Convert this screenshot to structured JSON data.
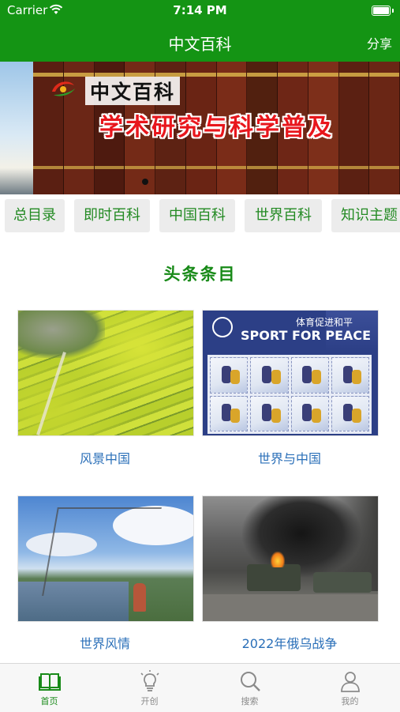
{
  "status_bar": {
    "carrier": "Carrier",
    "time": "7:14 PM"
  },
  "nav": {
    "title": "中文百科",
    "share_label": "分享"
  },
  "banner": {
    "logo_text": "中文百科",
    "slogan": "学术研究与科学普及",
    "page_indicator": {
      "current": 1,
      "total": 1
    }
  },
  "categories": [
    "总目录",
    "即时百科",
    "中国百科",
    "世界百科",
    "知识主题"
  ],
  "section_title": "头条条目",
  "articles": [
    {
      "label": "风景中国"
    },
    {
      "label": "世界与中国",
      "image_text_1": "体育促进和平",
      "image_text_2": "SPORT FOR PEACE"
    },
    {
      "label": "世界风情"
    },
    {
      "label": "2022年俄乌战争"
    }
  ],
  "tabs": [
    {
      "label": "首页",
      "icon": "book-icon",
      "active": true
    },
    {
      "label": "开创",
      "icon": "lightbulb-icon",
      "active": false
    },
    {
      "label": "搜索",
      "icon": "search-icon",
      "active": false
    },
    {
      "label": "我的",
      "icon": "person-icon",
      "active": false
    }
  ],
  "colors": {
    "brand_green": "#149414",
    "title_green": "#188a18",
    "link_blue": "#2a6fb8"
  }
}
